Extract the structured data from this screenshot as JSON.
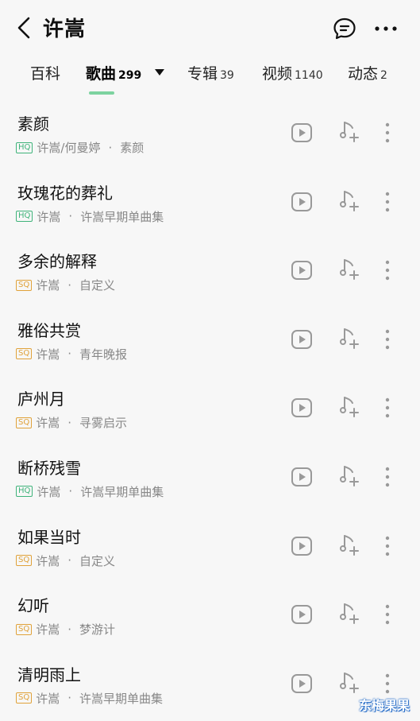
{
  "header": {
    "title": "许嵩"
  },
  "tabs": [
    {
      "label": "百科",
      "count": ""
    },
    {
      "label": "歌曲",
      "count": "299"
    },
    {
      "label": "专辑",
      "count": "39"
    },
    {
      "label": "视频",
      "count": "1140"
    },
    {
      "label": "动态",
      "count": "2"
    }
  ],
  "songs": [
    {
      "title": "素颜",
      "quality": "HQ",
      "artist": "许嵩/何曼婷",
      "album": "素颜"
    },
    {
      "title": "玫瑰花的葬礼",
      "quality": "HQ",
      "artist": "许嵩",
      "album": "许嵩早期单曲集"
    },
    {
      "title": "多余的解释",
      "quality": "SQ",
      "artist": "许嵩",
      "album": "自定义"
    },
    {
      "title": "雅俗共赏",
      "quality": "SQ",
      "artist": "许嵩",
      "album": "青年晚报"
    },
    {
      "title": "庐州月",
      "quality": "SQ",
      "artist": "许嵩",
      "album": "寻雾启示"
    },
    {
      "title": "断桥残雪",
      "quality": "HQ",
      "artist": "许嵩",
      "album": "许嵩早期单曲集"
    },
    {
      "title": "如果当时",
      "quality": "SQ",
      "artist": "许嵩",
      "album": "自定义"
    },
    {
      "title": "幻听",
      "quality": "SQ",
      "artist": "许嵩",
      "album": "梦游计"
    },
    {
      "title": "清明雨上",
      "quality": "SQ",
      "artist": "许嵩",
      "album": "许嵩早期单曲集"
    }
  ],
  "separator": "·",
  "watermark": "东梅果果",
  "colors": {
    "hq": "#3fb37a",
    "sq": "#e0a23a",
    "accent": "#7dd3a0"
  }
}
